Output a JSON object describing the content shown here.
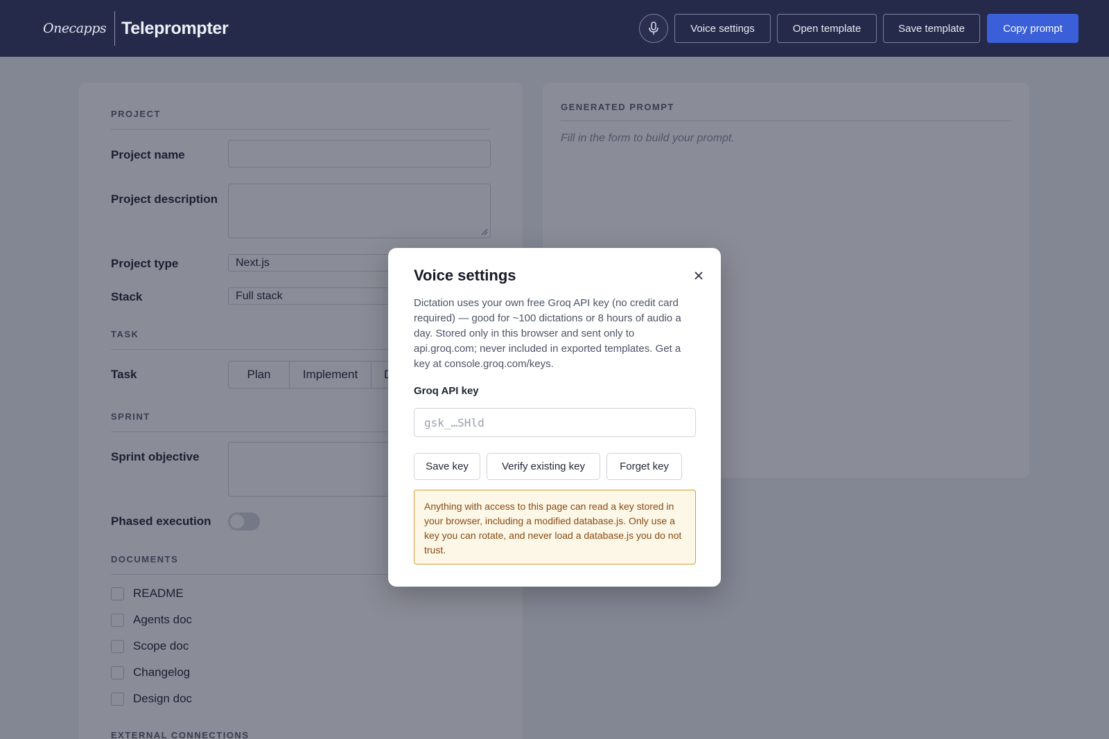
{
  "header": {
    "logo_text": "Onecapps",
    "app_title": "Teleprompter",
    "mic_icon": "microphone-icon",
    "buttons": {
      "voice_settings": "Voice settings",
      "open_template": "Open template",
      "save_template": "Save template",
      "copy_prompt": "Copy prompt"
    },
    "accent_color": "#3a5fd9"
  },
  "form": {
    "project": {
      "section_title": "PROJECT",
      "name_label": "Project name",
      "name_value": "",
      "description_label": "Project description",
      "description_value": "",
      "type_label": "Project type",
      "type_value": "Next.js",
      "stack_label": "Stack",
      "stack_value": "Full stack"
    },
    "task": {
      "section_title": "TASK",
      "label": "Task",
      "options": [
        "Plan",
        "Implement",
        "D"
      ]
    },
    "sprint": {
      "section_title": "SPRINT",
      "objective_label": "Sprint objective",
      "phased_label": "Phased execution",
      "phased_on": false
    },
    "documents": {
      "section_title": "DOCUMENTS",
      "items": [
        {
          "label": "README",
          "checked": false
        },
        {
          "label": "Agents doc",
          "checked": false
        },
        {
          "label": "Scope doc",
          "checked": false
        },
        {
          "label": "Changelog",
          "checked": false
        },
        {
          "label": "Design doc",
          "checked": false
        }
      ]
    },
    "external": {
      "section_title": "EXTERNAL CONNECTIONS"
    }
  },
  "prompt_panel": {
    "title": "GENERATED PROMPT",
    "placeholder": "Fill in the form to build your prompt."
  },
  "voice_modal": {
    "title": "Voice settings",
    "close_icon": "close-icon",
    "description": "Dictation uses your own free Groq API key (no credit card required) — good for ~100 dictations or 8 hours of audio a day. Stored only in this browser and sent only to api.groq.com; never included in exported templates. Get a key at console.groq.com/keys.",
    "key_label": "Groq API key",
    "key_placeholder": "gsk_…SHld",
    "buttons": {
      "save": "Save key",
      "verify": "Verify existing key",
      "forget": "Forget key"
    },
    "warning": "Anything with access to this page can read a key stored in your browser, including a modified database.js. Only use a key you can rotate, and never load a database.js you do not trust.",
    "warning_color": "#d89a32"
  }
}
